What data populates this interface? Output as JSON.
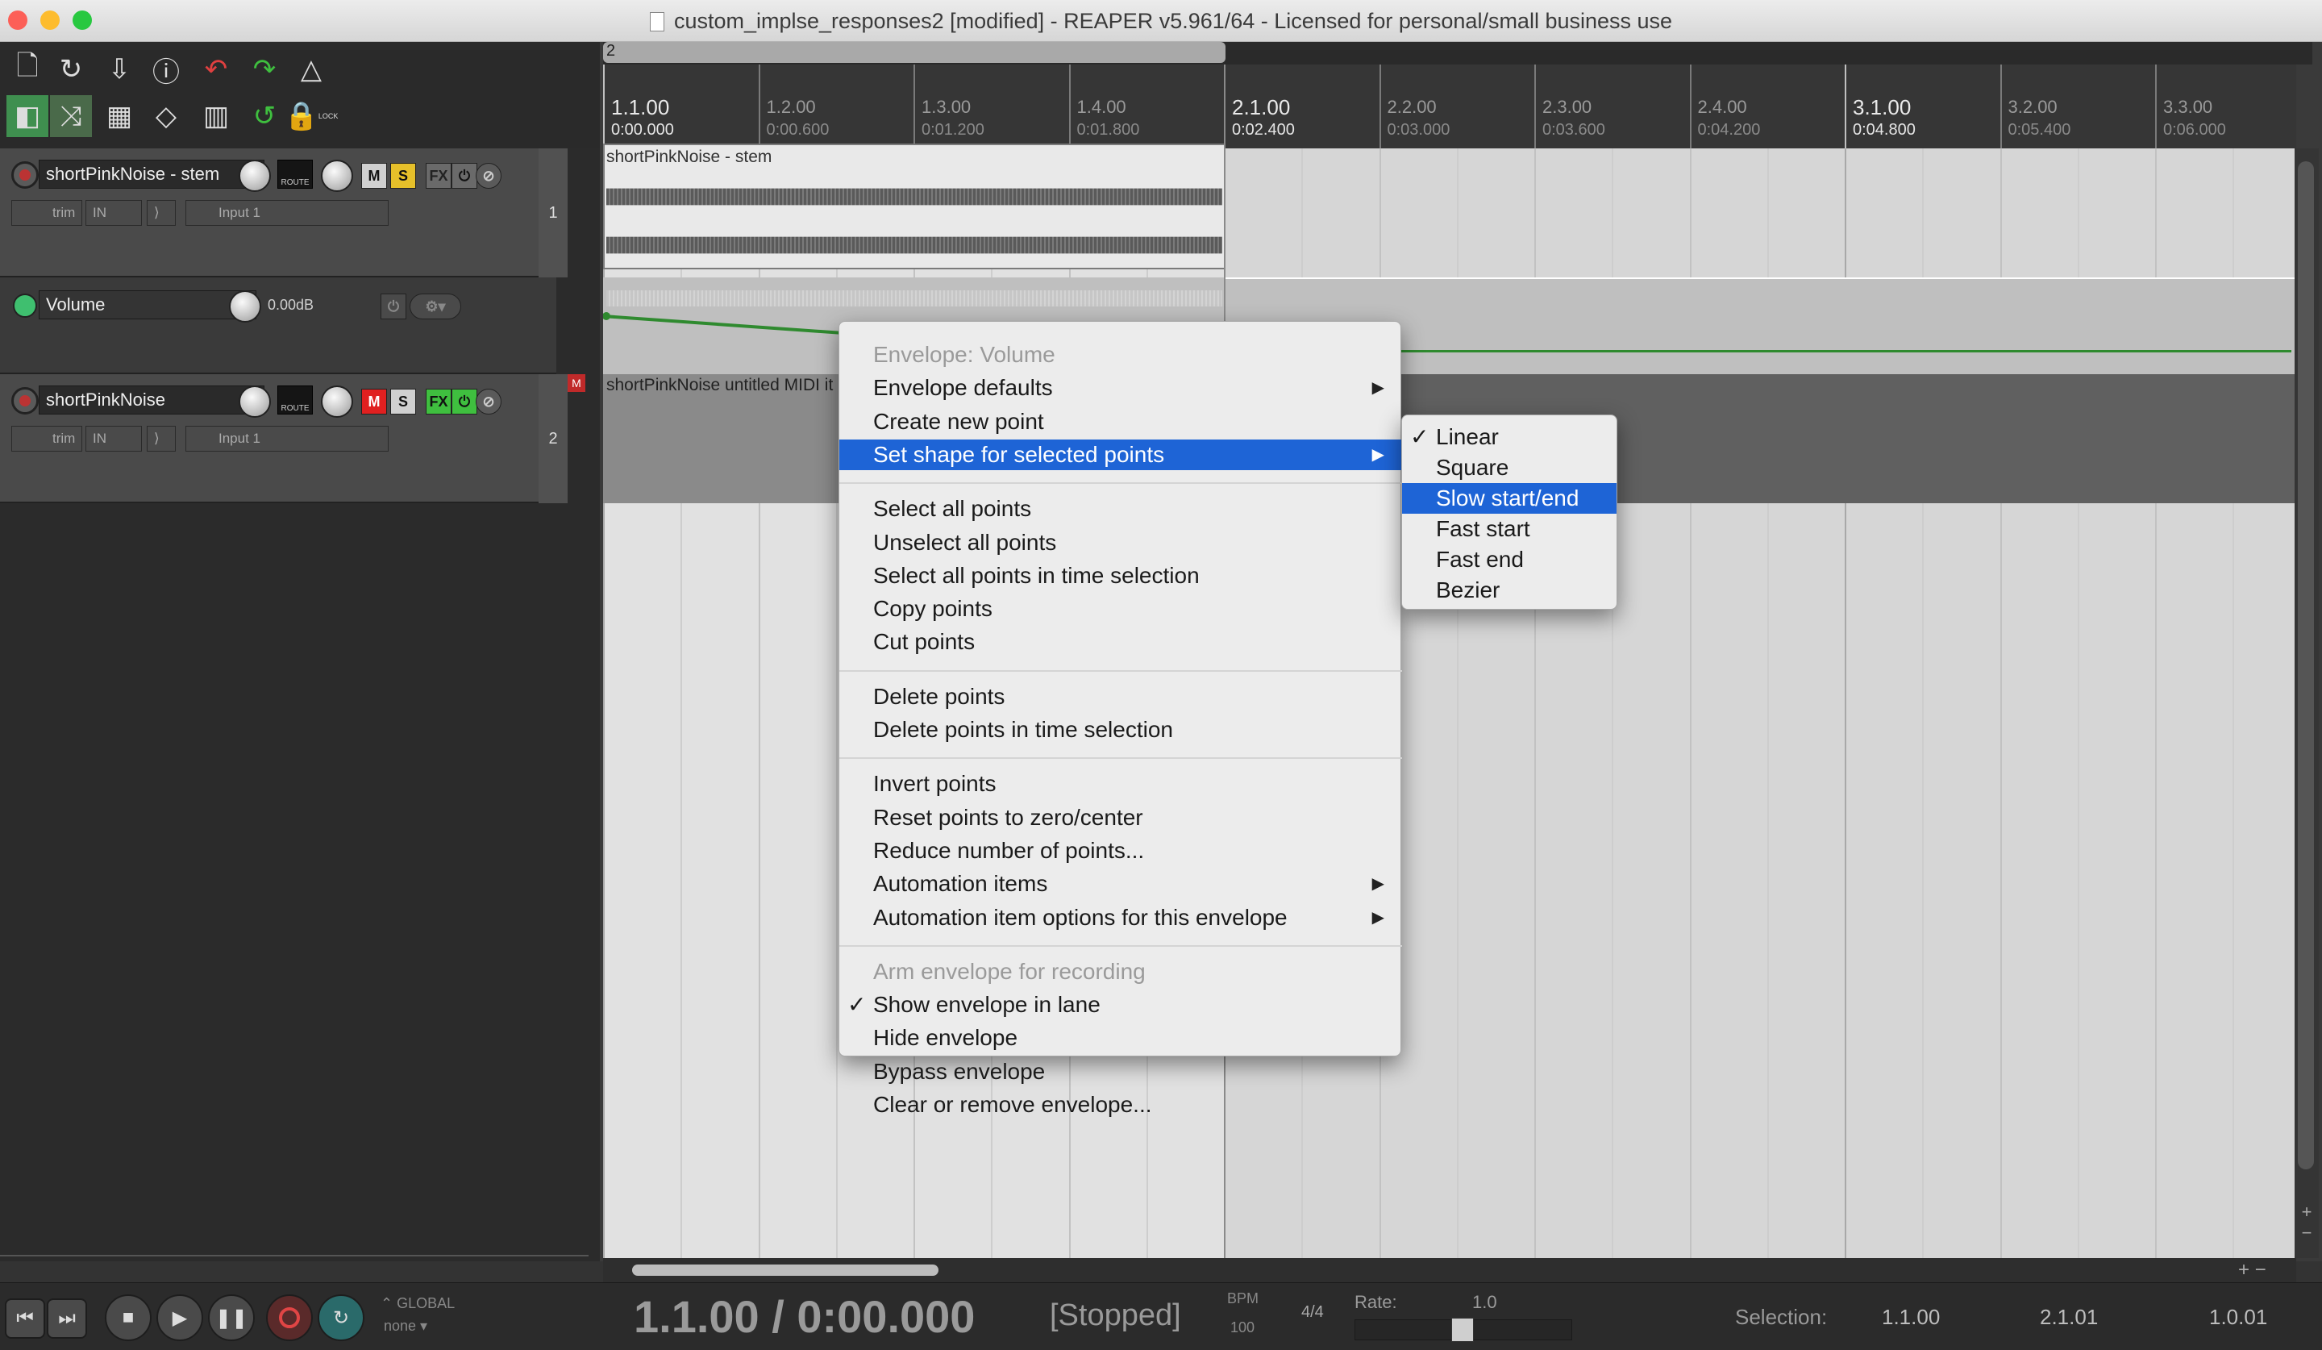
{
  "window": {
    "title": "custom_implse_responses2 [modified] - REAPER v5.961/64 - Licensed for personal/small business use",
    "traffic_colors": [
      "#fc5f57",
      "#fdbc2e",
      "#28c840"
    ]
  },
  "toolbar": {
    "row1_icons": [
      "new-project-icon",
      "open-project-icon",
      "save-project-icon",
      "project-settings-icon",
      "undo-icon",
      "redo-icon",
      "metronome-icon"
    ],
    "row2_icons": [
      "auto-crossfade-icon",
      "ripple-edit-icon",
      "grouping-icon",
      "envelope-points-icon",
      "snap-grid-icon",
      "loop-icon",
      "lock-icon"
    ],
    "lock_label": "LOCK"
  },
  "tracks": [
    {
      "name": "shortPinkNoise - stem",
      "mute": "M",
      "solo": "S",
      "fx": "FX",
      "route": "ROUTE",
      "trim": "trim",
      "in": "IN",
      "input": "Input 1",
      "number": "1"
    },
    {
      "name": "shortPinkNoise",
      "mute": "M",
      "solo": "S",
      "fx": "FX",
      "route": "ROUTE",
      "trim": "trim",
      "in": "IN",
      "input": "Input 1",
      "number": "2",
      "midi_badge": "M"
    }
  ],
  "envelope_lane": {
    "name": "Volume",
    "value": "0.00dB"
  },
  "arrange": {
    "region_label": "2",
    "ruler": [
      {
        "bar": "1.1.00",
        "time": "0:00.000",
        "major": true
      },
      {
        "bar": "1.2.00",
        "time": "0:00.600",
        "major": false
      },
      {
        "bar": "1.3.00",
        "time": "0:01.200",
        "major": false
      },
      {
        "bar": "1.4.00",
        "time": "0:01.800",
        "major": false
      },
      {
        "bar": "2.1.00",
        "time": "0:02.400",
        "major": true
      },
      {
        "bar": "2.2.00",
        "time": "0:03.000",
        "major": false
      },
      {
        "bar": "2.3.00",
        "time": "0:03.600",
        "major": false
      },
      {
        "bar": "2.4.00",
        "time": "0:04.200",
        "major": false
      },
      {
        "bar": "3.1.00",
        "time": "0:04.800",
        "major": true
      },
      {
        "bar": "3.2.00",
        "time": "0:05.400",
        "major": false
      },
      {
        "bar": "3.3.00",
        "time": "0:06.000",
        "major": false
      }
    ],
    "item1_label": "shortPinkNoise - stem",
    "item2_label": "shortPinkNoise untitled MIDI it"
  },
  "context_menu": {
    "items": [
      {
        "label": "Envelope: Volume",
        "disabled": true
      },
      {
        "label": "Envelope defaults",
        "submenu": true
      },
      {
        "label": "Create new point"
      },
      {
        "label": "Set shape for selected points",
        "submenu": true,
        "highlighted": true
      },
      {
        "sep": true
      },
      {
        "label": "Select all points"
      },
      {
        "label": "Unselect all points"
      },
      {
        "label": "Select all points in time selection"
      },
      {
        "label": "Copy points"
      },
      {
        "label": "Cut points"
      },
      {
        "sep": true
      },
      {
        "label": "Delete points"
      },
      {
        "label": "Delete points in time selection"
      },
      {
        "sep": true
      },
      {
        "label": "Invert points"
      },
      {
        "label": "Reset points to zero/center"
      },
      {
        "label": "Reduce number of points..."
      },
      {
        "label": "Automation items",
        "submenu": true
      },
      {
        "label": "Automation item options for this envelope",
        "submenu": true
      },
      {
        "sep": true
      },
      {
        "label": "Arm envelope for recording",
        "disabled": true
      },
      {
        "label": "Show envelope in lane",
        "checked": true
      },
      {
        "label": "Hide envelope"
      },
      {
        "label": "Bypass envelope"
      },
      {
        "label": "Clear or remove envelope..."
      }
    ]
  },
  "shape_submenu": {
    "items": [
      {
        "label": "Linear",
        "checked": true
      },
      {
        "label": "Square"
      },
      {
        "label": "Slow start/end",
        "highlighted": true
      },
      {
        "label": "Fast start"
      },
      {
        "label": "Fast end"
      },
      {
        "label": "Bezier"
      }
    ]
  },
  "transport": {
    "global_label": "GLOBAL",
    "global_value": "none",
    "time": "1.1.00 / 0:00.000",
    "status": "[Stopped]",
    "bpm_label": "BPM",
    "bpm_value": "100",
    "time_sig": "4/4",
    "rate_label": "Rate:",
    "rate_value": "1.0",
    "selection_label": "Selection:",
    "selection_start": "1.1.00",
    "selection_end": "2.1.01",
    "selection_length": "1.0.01"
  },
  "colors": {
    "menu_highlight": "#1e64d6",
    "envelope_green": "#2f8a2f",
    "record_red": "#b33",
    "fx_green": "#3fbf3f",
    "mute_red": "#e02020",
    "solo_yellow": "#e6c02a"
  }
}
